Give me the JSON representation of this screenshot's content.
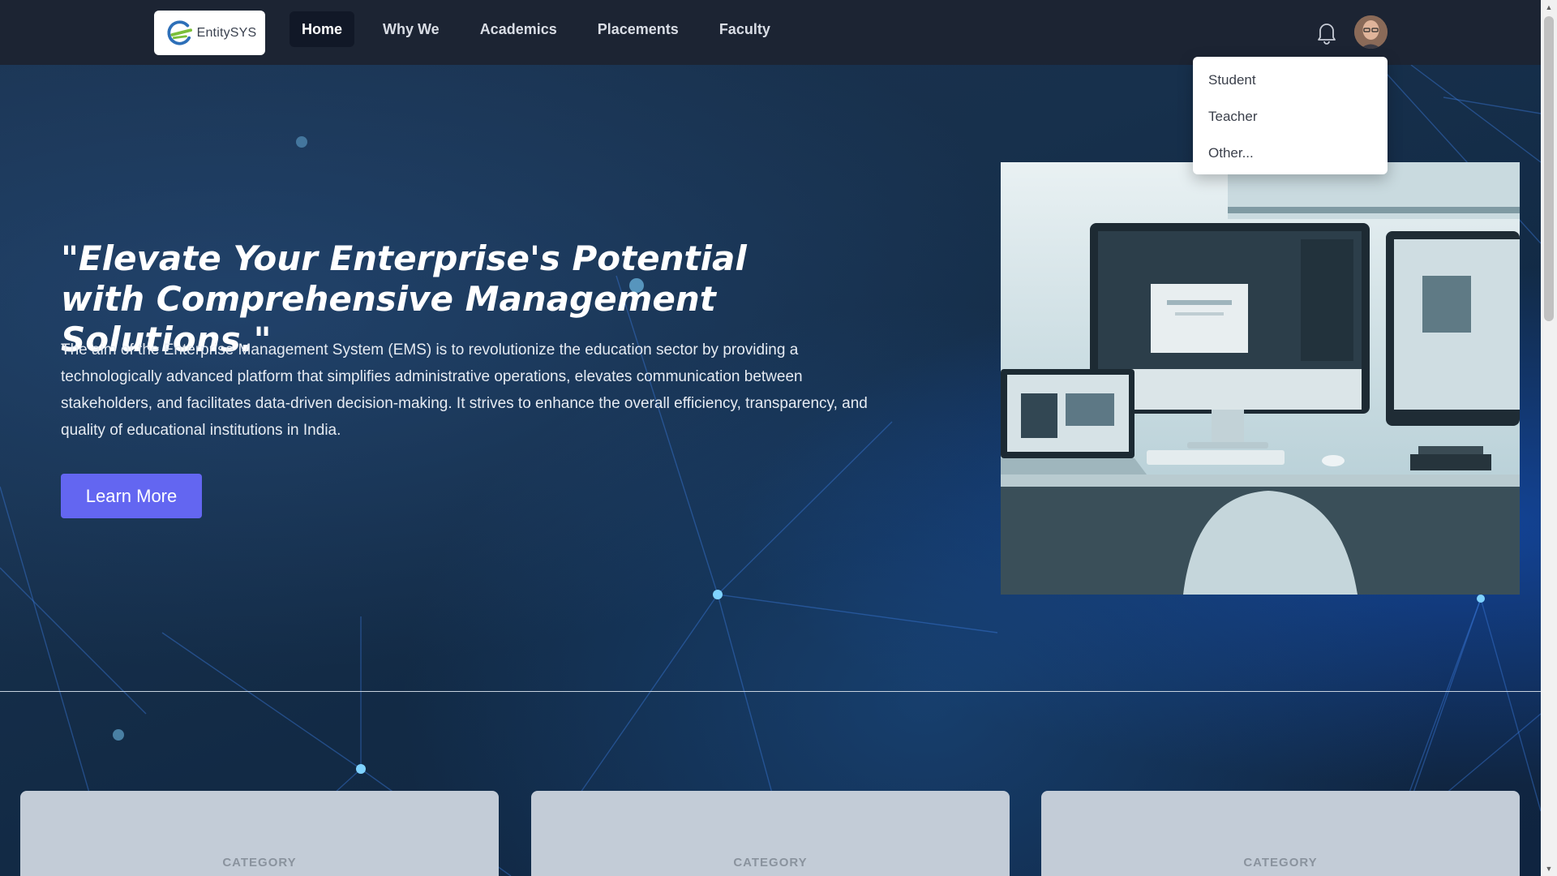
{
  "header": {
    "logo_text": "EntitySYS",
    "nav": [
      {
        "label": "Home",
        "active": true
      },
      {
        "label": "Why We",
        "active": false
      },
      {
        "label": "Academics",
        "active": false
      },
      {
        "label": "Placements",
        "active": false
      },
      {
        "label": "Faculty",
        "active": false
      }
    ],
    "icons": {
      "notifications": "bell-icon",
      "profile": "avatar"
    }
  },
  "dropdown": {
    "items": [
      "Student",
      "Teacher",
      "Other..."
    ]
  },
  "hero": {
    "title": "\"Elevate Your Enterprise's Potential with Comprehensive Management Solutions.\"",
    "description": "The aim of the Enterprise Management System (EMS) is to revolutionize the education sector by providing a technologically advanced platform that simplifies administrative operations, elevates communication between stakeholders, and facilitates data-driven decision-making. It strives to enhance the overall efficiency, transparency, and quality of educational institutions in India.",
    "button_label": "Learn More"
  },
  "cards": [
    {
      "label": "CATEGORY"
    },
    {
      "label": "CATEGORY"
    },
    {
      "label": "CATEGORY"
    }
  ],
  "colors": {
    "header_bg": "#1c2433",
    "accent": "#6366f1",
    "active_nav_bg": "#111827"
  }
}
